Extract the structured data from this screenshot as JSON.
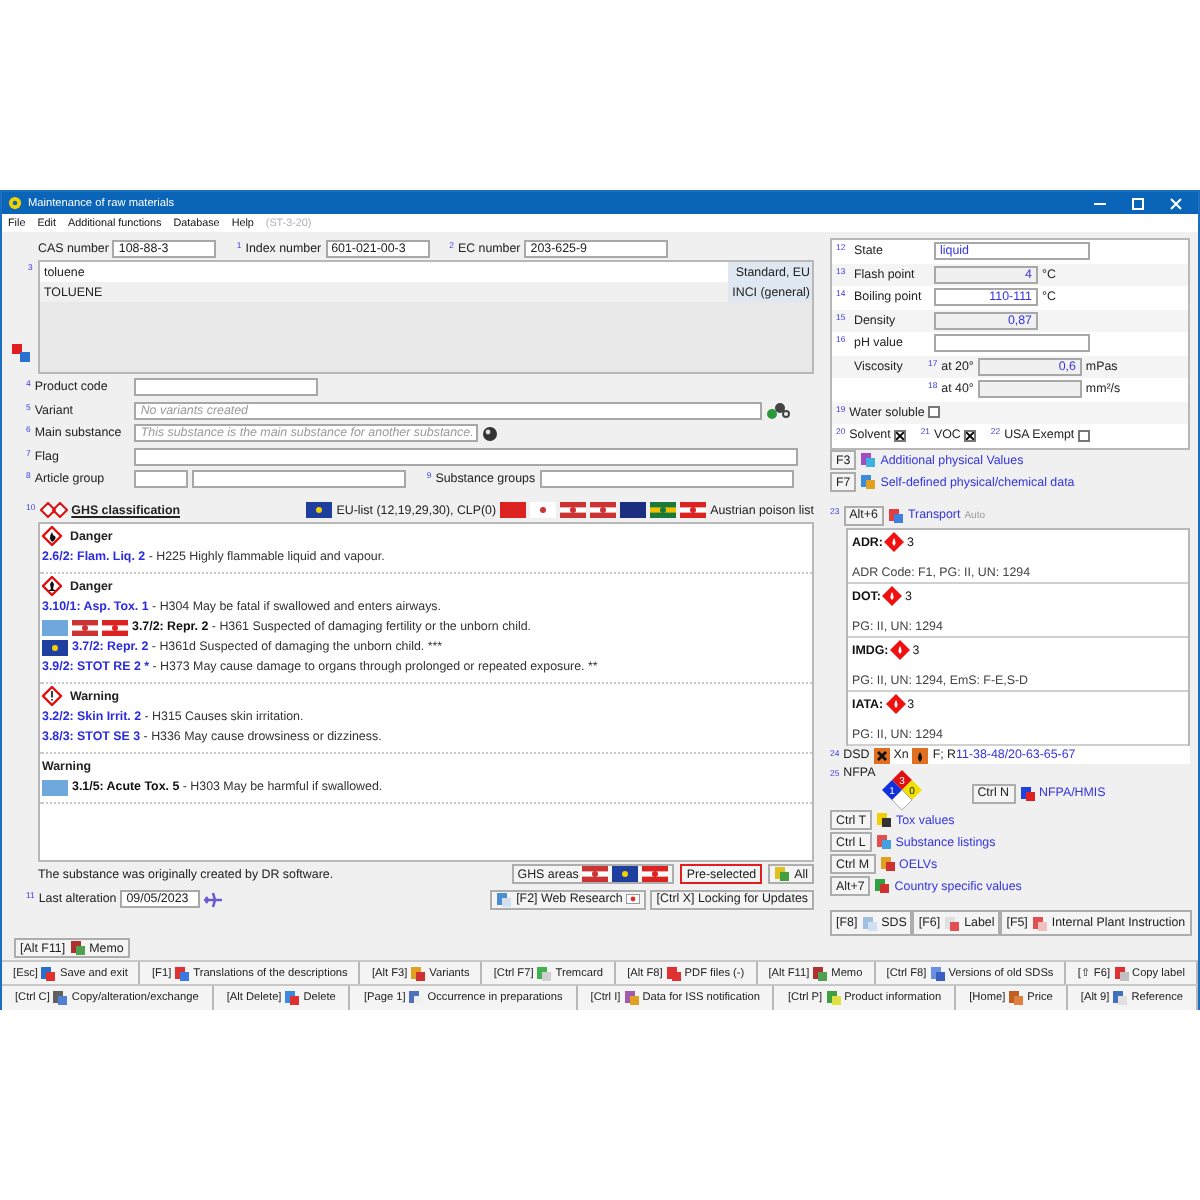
{
  "window": {
    "title": "Maintenance of raw materials"
  },
  "menu": [
    {
      "label": "File",
      "disabled": false
    },
    {
      "label": "Edit",
      "disabled": false
    },
    {
      "label": "Additional functions",
      "disabled": false
    },
    {
      "label": "Database",
      "disabled": false
    },
    {
      "label": "Help",
      "disabled": false
    },
    {
      "label": "(ST-3-20)",
      "disabled": true
    }
  ],
  "identifiers": [
    {
      "label": "CAS number",
      "value": "108-88-3"
    },
    {
      "num": "1",
      "label": "Index number",
      "value": "601-021-00-3"
    },
    {
      "num": "2",
      "label": "EC number",
      "value": "203-625-9"
    }
  ],
  "names": {
    "num": "3",
    "rows": [
      {
        "value": "toluene",
        "tag": "Standard, EU"
      },
      {
        "value": "TOLUENE",
        "tag": "INCI (general)"
      }
    ]
  },
  "fields": [
    {
      "kind": "short",
      "num": "4",
      "label": "Product code"
    },
    {
      "kind": "variant",
      "num": "5",
      "label": "Variant",
      "placeholder": "No variants created"
    },
    {
      "kind": "main",
      "num": "6",
      "label": "Main substance",
      "placeholder": "This substance is the main substance for another substance."
    },
    {
      "kind": "wide",
      "num": "7",
      "label": "Flag"
    },
    {
      "kind": "group",
      "num": "8",
      "label": "Article group",
      "extra_num": "9",
      "extra_label": "Substance groups"
    }
  ],
  "ghs": {
    "num": "10",
    "title": "GHS classification",
    "list": "EU-list (12,19,29,30), CLP(0)",
    "poison_list": "Austrian poison list",
    "groups": [
      {
        "signal": "Danger",
        "kind": "flame",
        "lines": [
          {
            "kind": "plain",
            "code": "2.6/2: Flam. Liq. 2",
            "text": "- H225 Highly flammable liquid and vapour."
          }
        ]
      },
      {
        "signal": "Danger",
        "kind": "health",
        "lines": [
          {
            "kind": "plain",
            "code": "3.10/1: Asp. Tox. 1",
            "text": "- H304 May be fatal if swallowed and enters airways."
          },
          {
            "kind": "intl",
            "code": "3.7/2: Repr. 2",
            "text": "- H361 Suspected of damaging fertility or the unborn child."
          },
          {
            "kind": "eu",
            "code": "3.7/2: Repr. 2",
            "text": "- H361d Suspected of damaging the unborn child. ***"
          },
          {
            "kind": "plain",
            "code": "3.9/2: STOT RE 2 *",
            "text": "- H373 May cause damage to organs through prolonged or repeated exposure. **"
          }
        ]
      },
      {
        "signal": "Warning",
        "kind": "exclamation",
        "lines": [
          {
            "kind": "plain",
            "code": "3.2/2: Skin Irrit. 2",
            "text": "- H315 Causes skin irritation."
          },
          {
            "kind": "plain",
            "code": "3.8/3: STOT SE 3",
            "text": "- H336 May cause drowsiness or dizziness."
          }
        ]
      },
      {
        "signal": "Warning",
        "kind": "plain",
        "lines": [
          {
            "kind": "un",
            "code": "3.1/5: Acute Tox. 5",
            "text": "- H303 May be harmful if swallowed."
          }
        ]
      }
    ],
    "note": "The substance was originally created by DR software.",
    "areas_label": "GHS areas",
    "area_buttons": [
      {
        "label": "Pre-selected",
        "selected": true
      },
      {
        "label": "All",
        "selected": false
      }
    ]
  },
  "last_alteration": {
    "num": "11",
    "label": "Last alteration",
    "value": "09/05/2023"
  },
  "actions": [
    {
      "key": "[F2]",
      "label": "Web Research"
    },
    {
      "key": "[Ctrl X]",
      "label": "Locking for Updates"
    }
  ],
  "memo": {
    "key": "[Alt F11]",
    "label": "Memo"
  },
  "properties": [
    {
      "kind": "text",
      "num": "12",
      "label": "State",
      "value": "liquid"
    },
    {
      "kind": "number",
      "num": "13",
      "label": "Flash point",
      "value": "4",
      "unit": "°C"
    },
    {
      "kind": "number",
      "num": "14",
      "label": "Boiling point",
      "value": "110-111",
      "unit": "°C"
    },
    {
      "kind": "number",
      "num": "15",
      "label": "Density",
      "value": "0,87"
    },
    {
      "kind": "text",
      "num": "16",
      "label": "pH value"
    },
    {
      "kind": "sub",
      "label": "Viscosity",
      "num": "17",
      "sublabel": "at 20°",
      "value": "0,6",
      "unit": "mPas"
    },
    {
      "kind": "sub",
      "num": "18",
      "sublabel": "at 40°",
      "unit": "mm²/s"
    },
    {
      "kind": "checks",
      "items": [
        {
          "num": "19",
          "label": "Water soluble",
          "checked": false
        }
      ]
    },
    {
      "kind": "checks",
      "items": [
        {
          "num": "20",
          "label": "Solvent",
          "checked": true
        },
        {
          "num": "21",
          "label": "VOC",
          "checked": true
        },
        {
          "num": "22",
          "label": "USA Exempt",
          "checked": false
        }
      ]
    }
  ],
  "data_links": [
    {
      "key": "F3",
      "label": "Additional physical Values"
    },
    {
      "key": "F7",
      "label": "Self-defined physical/chemical data"
    }
  ],
  "transport": {
    "num": "23",
    "key": "Alt+6",
    "title": "Transport",
    "mode": "Auto",
    "entries": [
      {
        "mode": "ADR:",
        "class": "3",
        "details": "ADR Code: F1, PG: II, UN: 1294"
      },
      {
        "mode": "DOT:",
        "class": "3",
        "details": "PG: II, UN: 1294"
      },
      {
        "mode": "IMDG:",
        "class": "3",
        "details": "PG: II, UN: 1294, EmS: F-E,S-D"
      },
      {
        "mode": "IATA:",
        "class": "3",
        "details": "PG: II, UN: 1294"
      }
    ]
  },
  "dsd": {
    "num": "24",
    "label": "DSD",
    "symbol_1": "Xn",
    "symbol_2": "F; R",
    "phrases": "11-38-48/20-63-65-67"
  },
  "nfpa": {
    "num": "25",
    "label": "NFPA",
    "health": "1",
    "flammability": "3",
    "reactivity": "0",
    "key": "Ctrl N",
    "link": "NFPA/HMIS"
  },
  "more_links": [
    {
      "key": "Ctrl T",
      "label": "Tox values"
    },
    {
      "key": "Ctrl L",
      "label": "Substance listings"
    },
    {
      "key": "Ctrl M",
      "label": "OELVs"
    },
    {
      "key": "Alt+7",
      "label": "Country specific values"
    }
  ],
  "documents": [
    {
      "key": "[F8]",
      "label": "SDS"
    },
    {
      "key": "[F6]",
      "label": "Label"
    },
    {
      "key": "[F5]",
      "label": "Internal Plant Instruction"
    }
  ],
  "toolbar_rows": [
    [
      {
        "key": "[Esc]",
        "label": "Save and exit"
      },
      {
        "key": "[F1]",
        "label": "Translations of the descriptions"
      },
      {
        "key": "[Alt F3]",
        "label": "Variants"
      },
      {
        "key": "[Ctrl F7]",
        "label": "Tremcard"
      },
      {
        "key": "[Alt F8]",
        "label": "PDF files (-)"
      },
      {
        "key": "[Alt F11]",
        "label": "Memo"
      },
      {
        "key": "[Ctrl F8]",
        "label": "Versions of old SDSs"
      },
      {
        "key": "[⇧ F6]",
        "label": "Copy label"
      }
    ],
    [
      {
        "key": "[Ctrl C]",
        "label": "Copy/alteration/exchange"
      },
      {
        "key": "[Alt Delete]",
        "label": "Delete"
      },
      {
        "key": "[Page 1]",
        "label": "Occurrence in preparations"
      },
      {
        "key": "[Ctrl I]",
        "label": "Data for ISS notification"
      },
      {
        "key": "[Ctrl P]",
        "label": "Product information"
      },
      {
        "key": "[Home]",
        "label": "Price"
      },
      {
        "key": "[Alt 9]",
        "label": "Reference"
      }
    ]
  ]
}
